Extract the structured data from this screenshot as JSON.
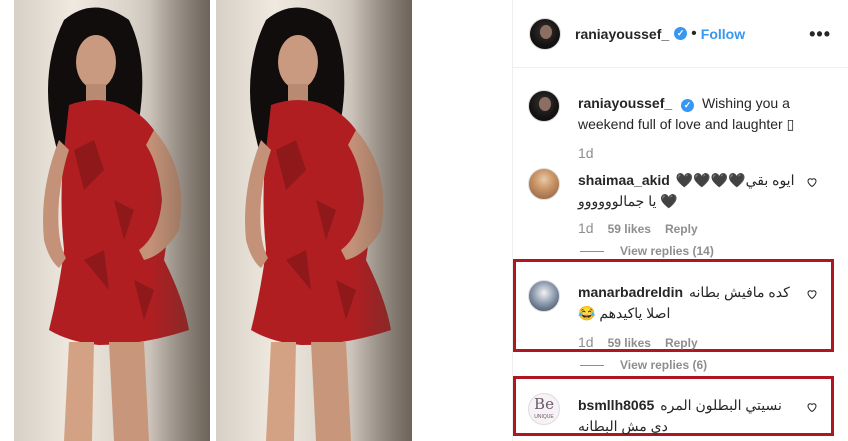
{
  "post": {
    "username": "raniayoussef_",
    "verified_mark": "✓",
    "dot": "•",
    "follow_label": "Follow",
    "more_label": "•••"
  },
  "caption": {
    "username": "raniayoussef_",
    "text": "Wishing you a weekend full of love and laughter ",
    "emoji_box": "▯",
    "age": "1d"
  },
  "comments": [
    {
      "username": "shaimaa_akid",
      "text": "ايوه بقي🖤🖤🖤🖤🖤 يا جمالوووووو",
      "age": "1d",
      "likes": "59 likes",
      "reply": "Reply",
      "view_replies": "View replies (14)"
    },
    {
      "username": "manarbadreldin",
      "text": "كده مافيش بطانه اصلا ياكيدهم 😂",
      "age": "1d",
      "likes": "59 likes",
      "reply": "Reply",
      "view_replies": "View replies (6)"
    },
    {
      "username": "bsmllh8065",
      "text": "نسيتي البطلون المره دي مش البطانه",
      "avatar_text": "Be",
      "avatar_subtext": "UNIQUE"
    }
  ],
  "colors": {
    "accent": "#3897f0",
    "highlight_box": "#b0161f",
    "muted": "#8e8e8e"
  },
  "icons": {
    "verified": "verified-badge-icon",
    "heart": "heart-outline-icon",
    "more": "more-options-icon"
  }
}
